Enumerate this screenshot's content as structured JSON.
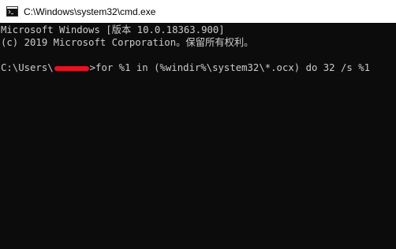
{
  "window": {
    "title": "C:\\Windows\\system32\\cmd.exe",
    "icon": "cmd-icon"
  },
  "console": {
    "lines": [
      "Microsoft Windows [版本 10.0.18363.900]",
      "(c) 2019 Microsoft Corporation。保留所有权利。",
      ""
    ],
    "prompt": {
      "prefix": "C:\\Users\\",
      "redacted_username": "",
      "suffix": ">",
      "command": "for %1 in (%windir%\\system32\\*.ocx) do 32 /s %1"
    }
  },
  "colors": {
    "console_bg": "#0c0c0c",
    "console_fg": "#cccccc",
    "titlebar_bg": "#ffffff",
    "redaction": "#e81123"
  }
}
